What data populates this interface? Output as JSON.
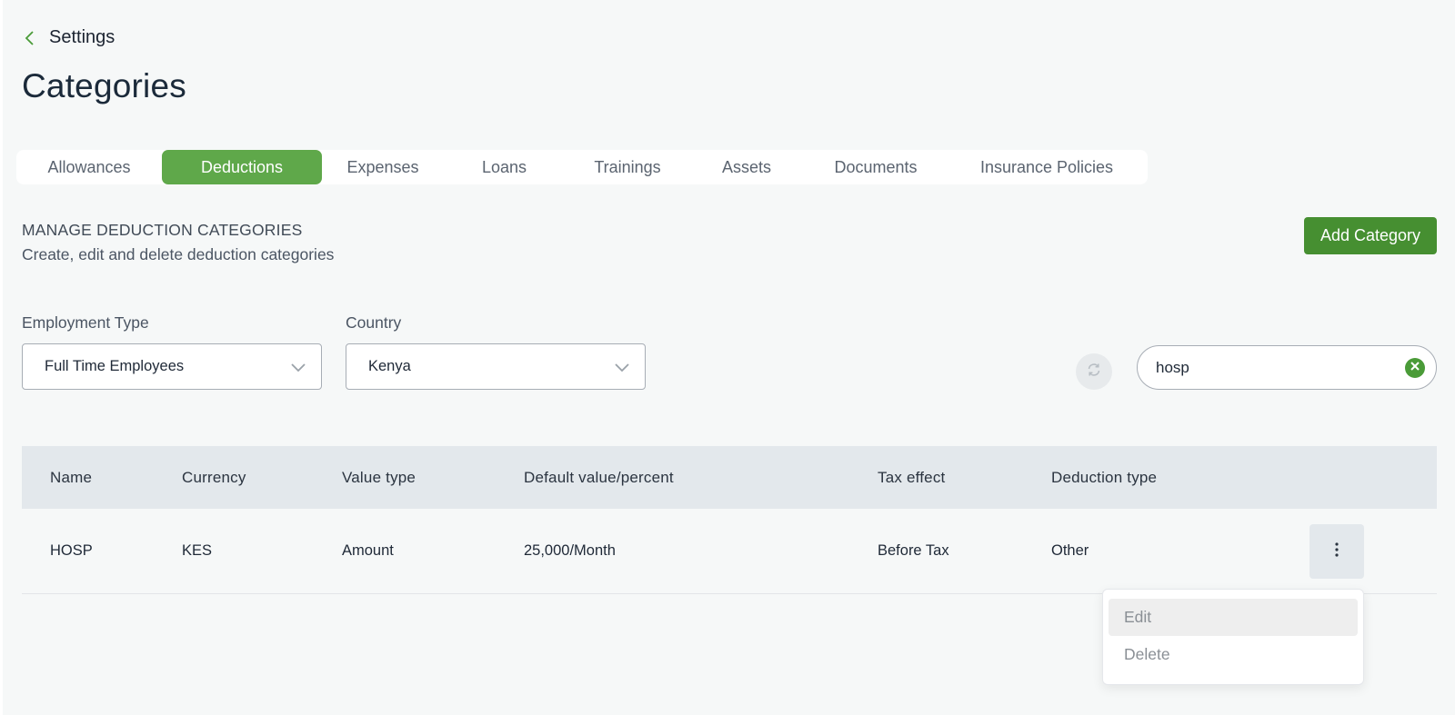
{
  "nav": {
    "back_label": "Settings"
  },
  "page": {
    "title": "Categories"
  },
  "tabs": [
    {
      "label": "Allowances",
      "active": false
    },
    {
      "label": "Deductions",
      "active": true
    },
    {
      "label": "Expenses",
      "active": false
    },
    {
      "label": "Loans",
      "active": false
    },
    {
      "label": "Trainings",
      "active": false
    },
    {
      "label": "Assets",
      "active": false
    },
    {
      "label": "Documents",
      "active": false
    },
    {
      "label": "Insurance Policies",
      "active": false
    }
  ],
  "section": {
    "heading": "MANAGE DEDUCTION CATEGORIES",
    "subheading": "Create, edit and delete deduction categories",
    "add_button": "Add Category"
  },
  "filters": {
    "employment_type": {
      "label": "Employment Type",
      "value": "Full Time Employees"
    },
    "country": {
      "label": "Country",
      "value": "Kenya"
    }
  },
  "search": {
    "value": "hosp"
  },
  "table": {
    "headers": [
      "Name",
      "Currency",
      "Value type",
      "Default value/percent",
      "Tax effect",
      "Deduction type"
    ],
    "rows": [
      [
        "HOSP",
        "KES",
        "Amount",
        "25,000/Month",
        "Before Tax",
        "Other"
      ]
    ]
  },
  "row_menu": {
    "items": [
      "Edit",
      "Delete"
    ]
  },
  "colors": {
    "accent": "#5fa84a",
    "primary_button": "#468f31",
    "header_bg": "#e3e8ec",
    "page_bg": "#f6f8f8"
  },
  "icons": [
    "chevron-left-icon",
    "chevron-down-icon",
    "refresh-icon",
    "clear-icon",
    "more-vertical-icon"
  ]
}
